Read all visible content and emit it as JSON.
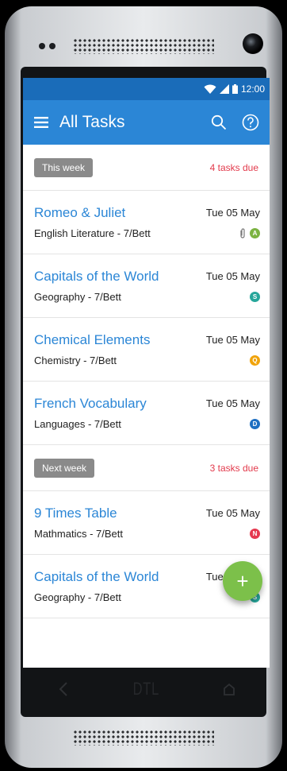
{
  "statusbar": {
    "time": "12:00"
  },
  "appbar": {
    "title": "All Tasks",
    "menu_icon": "hamburger-menu-icon",
    "search_icon": "search-icon",
    "help_icon": "help-icon"
  },
  "colors": {
    "statusbar": "#1a6cb9",
    "appbar": "#2b86d6",
    "accent_title": "#2b86d6",
    "due_red": "#e23a4c",
    "chip_gray": "#8a8a8a",
    "fab_green": "#7cc04a"
  },
  "sections": [
    {
      "label": "This week",
      "due": "4 tasks due",
      "tasks": [
        {
          "title": "Romeo & Juliet",
          "subtitle": "English Literature - 7/Bett",
          "date": "Tue 05 May",
          "badge": "A",
          "badge_color": "#7cb342",
          "attachment": true
        },
        {
          "title": "Capitals of the World",
          "subtitle": "Geography - 7/Bett",
          "date": "Tue 05 May",
          "badge": "S",
          "badge_color": "#26a69a",
          "attachment": false
        },
        {
          "title": "Chemical Elements",
          "subtitle": "Chemistry - 7/Bett",
          "date": "Tue 05 May",
          "badge": "Q",
          "badge_color": "#f0a30a",
          "attachment": false
        },
        {
          "title": "French Vocabulary",
          "subtitle": "Languages - 7/Bett",
          "date": "Tue 05 May",
          "badge": "D",
          "badge_color": "#1e6fc2",
          "attachment": false
        }
      ]
    },
    {
      "label": "Next week",
      "due": "3 tasks due",
      "tasks": [
        {
          "title": "9 Times Table",
          "subtitle": "Mathmatics - 7/Bett",
          "date": "Tue 05 May",
          "badge": "N",
          "badge_color": "#e53950",
          "attachment": false
        },
        {
          "title": "Capitals of the World",
          "subtitle": "Geography - 7/Bett",
          "date": "Tue 05 May",
          "badge": "S",
          "badge_color": "#26a69a",
          "attachment": false
        }
      ]
    }
  ],
  "fab": {
    "label": "+"
  },
  "device": {
    "brand": "DTL"
  }
}
